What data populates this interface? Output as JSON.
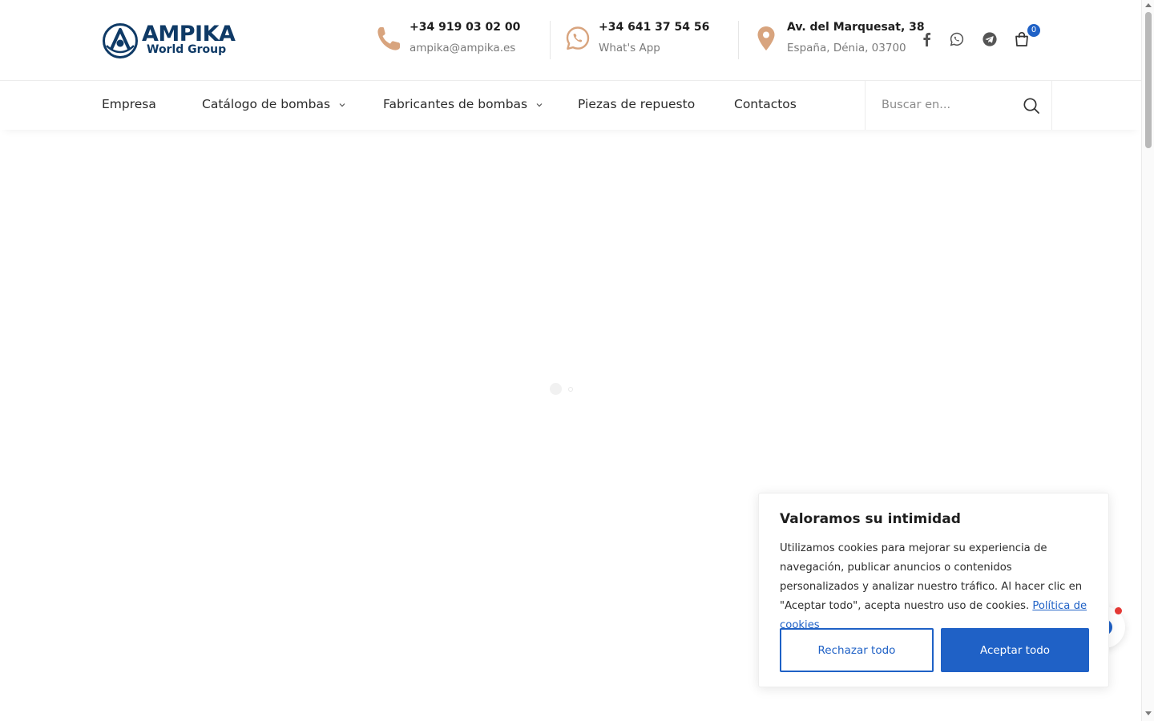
{
  "header": {
    "logo": {
      "name": "AMPIKA",
      "subtitle": "World Group"
    },
    "contacts": [
      {
        "icon": "phone-icon",
        "title": "+34 919 03 02 00",
        "subtitle": "ampika@ampika.es"
      },
      {
        "icon": "whatsapp-icon",
        "title": "+34 641 37 54 56",
        "subtitle": "What's App"
      },
      {
        "icon": "map-pin-icon",
        "title": "Av. del Marquesat, 38",
        "subtitle": "España, Dénia, 03700"
      }
    ],
    "social": [
      "facebook-icon",
      "whatsapp-icon",
      "telegram-icon"
    ],
    "cart": {
      "icon": "shopping-bag-icon",
      "count": "0"
    }
  },
  "nav": {
    "items": [
      {
        "label": "Empresa",
        "has_dropdown": false
      },
      {
        "label": "Catálogo de bombas",
        "has_dropdown": true
      },
      {
        "label": "Fabricantes de bombas",
        "has_dropdown": true
      },
      {
        "label": "Piezas de repuesto",
        "has_dropdown": false
      },
      {
        "label": "Contactos",
        "has_dropdown": false
      }
    ],
    "search": {
      "placeholder": "Buscar en...",
      "value": ""
    }
  },
  "cookie": {
    "title": "Valoramos su intimidad",
    "text": "Utilizamos cookies para mejorar su experiencia de navegación, publicar anuncios o contenidos personalizados y analizar nuestro tráfico. Al hacer clic en \"Aceptar todo\", acepta nuestro uso de cookies.",
    "link": "Política de cookies",
    "reject": "Rechazar todo",
    "accept": "Aceptar todo"
  },
  "colors": {
    "accent": "#1f61c6",
    "icon_tan": "#d8a47e",
    "brand_navy": "#0f3a66"
  }
}
